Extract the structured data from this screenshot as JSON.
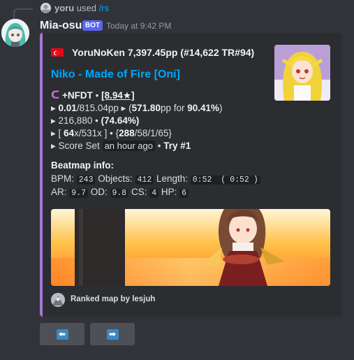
{
  "reply": {
    "username": "yoru",
    "used_text": "used",
    "command": "/rs"
  },
  "message": {
    "author": "Mia-osu",
    "bot_tag": "BOT",
    "timestamp": "Today at 9:42 PM"
  },
  "embed": {
    "accent_color": "#a178d4",
    "author_line": "YoruNoKen 7,397.45pp (#14,622 TR#94)",
    "title": "Niko - Made of Fire [Oni]",
    "mods_line": {
      "mods": "+NFDT",
      "sep": " • ",
      "stars": "[8.94★]"
    },
    "pp_line": {
      "prefix": "▸ ",
      "pp": "0.01",
      "pp_max": "/815.04pp",
      "mid": " ▸ (",
      "fc_pp": "571.80",
      "fc_mid": "pp for ",
      "fc_acc": "90.41%",
      "end": ")"
    },
    "score_line": {
      "prefix": "▸ ",
      "score": "216,880",
      "sep": " • ",
      "acc": "(74.64%)"
    },
    "combo_line": {
      "prefix": "▸ [ ",
      "combo": "64",
      "combo_max": "x/531x ] • {",
      "hits": "288",
      "hits_rest": "/58/1/65}"
    },
    "set_line": {
      "prefix": "▸ Score Set ",
      "time": "an hour ago",
      "sep": " • ",
      "try": "Try #1"
    },
    "field_name": "Beatmap info:",
    "info_row1": {
      "bpm_label": "BPM: ",
      "bpm": "243",
      "objects_label": " Objects: ",
      "objects": "412",
      "length_label": " Length: ",
      "length": "0:52",
      "length_paren_open": " (",
      "length_dt": "0:52",
      "length_paren_close": ")"
    },
    "info_row2": {
      "ar_label": "AR: ",
      "ar": "9.7",
      "od_label": " OD: ",
      "od": "9.8",
      "cs_label": " CS: ",
      "cs": "4",
      "hp_label": " HP: ",
      "hp": "6"
    },
    "footer": "Ranked map by lesjuh"
  },
  "buttons": {
    "prev_icon": "⬅",
    "next_icon": "➡"
  },
  "icons": {
    "flag": "turkey-flag-icon",
    "prev": "arrow-left-icon",
    "next": "arrow-right-icon"
  }
}
